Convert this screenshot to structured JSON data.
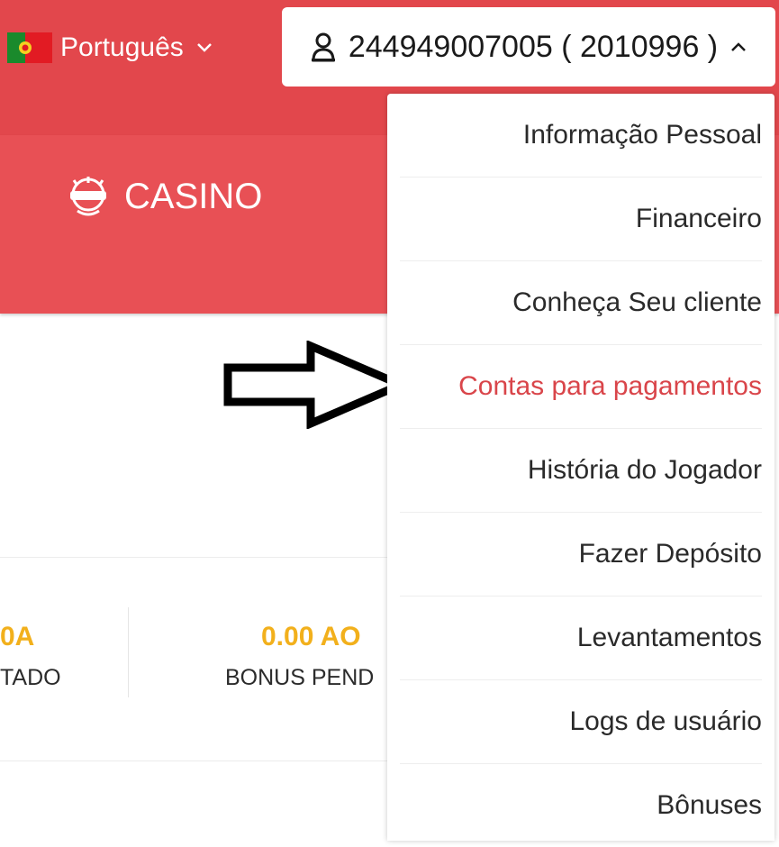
{
  "header": {
    "language": {
      "flag_icon": "portugal-flag-icon",
      "label": "Português"
    },
    "account": {
      "icon": "user-icon",
      "label": "244949007005 ( 2010996 )"
    }
  },
  "nav": {
    "casino_label": "CASINO"
  },
  "stats": [
    {
      "amount": "0A",
      "label": "TADO"
    },
    {
      "amount": "0.00 AO",
      "label": "BONUS PEND"
    }
  ],
  "dropdown": {
    "items": [
      {
        "label": "Informação Pessoal"
      },
      {
        "label": "Financeiro"
      },
      {
        "label": "Conheça Seu cliente"
      },
      {
        "label": "Contas para pagamentos"
      },
      {
        "label": "História do Jogador"
      },
      {
        "label": "Fazer Depósito"
      },
      {
        "label": "Levantamentos"
      },
      {
        "label": "Logs de usuário"
      },
      {
        "label": "Bônuses"
      }
    ],
    "active_item": "Contas para pagamentos"
  },
  "colors": {
    "brand_red": "#e2474c",
    "active_text": "#d9454a",
    "amount_yellow": "#f2b01c"
  }
}
